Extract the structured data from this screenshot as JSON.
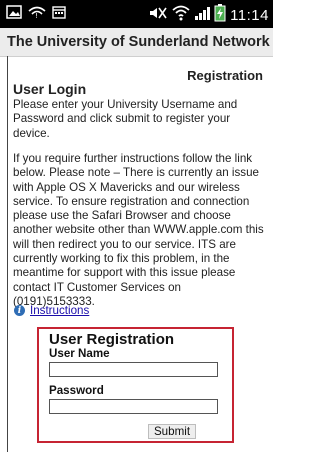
{
  "status_bar": {
    "time": "11:14",
    "left_icons": [
      "image-icon",
      "signal-alert-icon",
      "calendar-icon"
    ],
    "right_icons": [
      "mute-icon",
      "wifi-icon",
      "cell-signal-icon",
      "battery-charging-icon"
    ]
  },
  "header": {
    "title": "The University of Sunderland Network"
  },
  "page": {
    "registration_label": "Registration",
    "login_heading": "User Login",
    "intro_text": "Please enter your University Username and Password and click submit to register your device.",
    "notice_text": "If you require further instructions follow the link below. Please note – There is currently an issue with Apple OS X Mavericks and our wireless service. To ensure registration and connection please use the Safari Browser and choose another website other than WWW.apple.com this will then redirect you to our service. ITS are currently working to fix this problem, in the meantime for support with this issue please contact IT Customer Services on (0191)5153333.",
    "instructions_link": "Instructions"
  },
  "registration_form": {
    "title": "User Registration",
    "username_label": "User Name",
    "username_value": "",
    "password_label": "Password",
    "password_value": "",
    "submit_label": "Submit",
    "border_color": "#c62433"
  }
}
